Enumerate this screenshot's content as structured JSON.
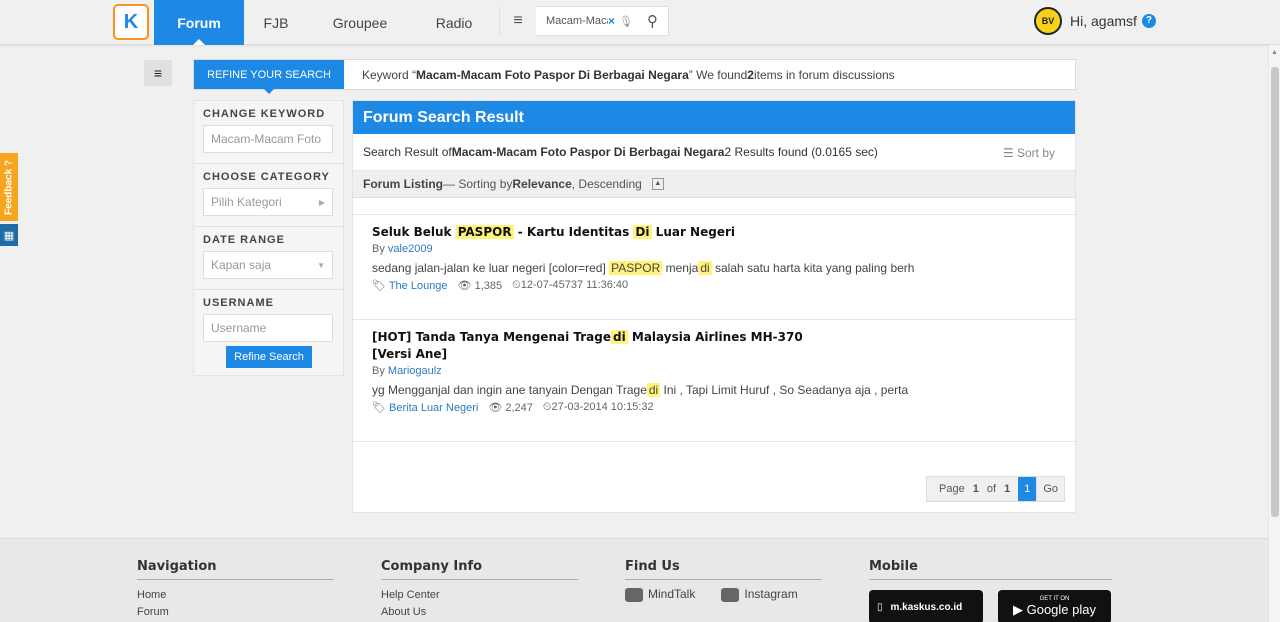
{
  "nav": {
    "logo": "K",
    "tabs": [
      "Forum",
      "FJB",
      "Groupee",
      "Radio"
    ],
    "search_value": "Macam-Macam Foto Paspor Di Berbagai Negara",
    "user_greeting": "Hi, agamsf",
    "avatar_text": "BV"
  },
  "feedback": "Feedback ?",
  "refine": {
    "tab_label": "REFINE YOUR SEARCH",
    "keyword_prefix": "Keyword “",
    "keyword": "Macam-Macam Foto Paspor Di Berbagai Negara",
    "keyword_suffix_1": "” We found ",
    "count": "2",
    "keyword_suffix_2": " items in forum discussions"
  },
  "sidebar": {
    "change_keyword": "CHANGE KEYWORD",
    "keyword_value": "Macam-Macam Foto",
    "choose_category": "CHOOSE CATEGORY",
    "category_placeholder": "Pilih Kategori",
    "date_range": "DATE RANGE",
    "date_value": "Kapan saja",
    "username": "USERNAME",
    "username_placeholder": "Username",
    "button": "Refine Search"
  },
  "results": {
    "header": "Forum Search Result",
    "summary_prefix": "Search Result of ",
    "summary_keyword": "Macam-Macam Foto Paspor Di Berbagai Negara",
    "summary_suffix": " 2 Results found (0.0165 sec)",
    "sort_by": "Sort by",
    "listing_label": "Forum Listing",
    "listing_sorting": " — Sorting by ",
    "listing_relevance": "Relevance",
    "listing_order": ", Descending",
    "threads": [
      {
        "title_parts": [
          "Seluk Beluk ",
          "PASPOR",
          " - Kartu Identitas ",
          "Di",
          " Luar Negeri"
        ],
        "by": "By ",
        "author": "vale2009",
        "snippet_parts": [
          "sedang jalan-jalan ke luar negeri [color=red] ",
          "PASPOR",
          " menja",
          "di",
          " salah satu harta kita yang paling berh"
        ],
        "category": "The Lounge",
        "views": "1,385",
        "date": "12-07-45737 11:36:40"
      },
      {
        "title_parts": [
          "[HOT] Tanda Tanya Mengenai Trage",
          "di",
          " Malaysia Airlines MH-370"
        ],
        "title_line2": "[Versi Ane]",
        "by": "By ",
        "author": "Mariogaulz",
        "snippet_parts": [
          "yg Mengganjal dan ingin ane tanyain Dengan Trage",
          "di",
          " Ini , Tapi Limit Huruf , So Seadanya aja , perta"
        ],
        "category": "Berita Luar Negeri",
        "views": "2,247",
        "date": "27-03-2014 10:15:32"
      }
    ],
    "pager": {
      "label_prefix": "Page ",
      "page": "1",
      "of": " of ",
      "total": "1",
      "current": "1",
      "go": "Go"
    }
  },
  "footer": {
    "navigation": {
      "title": "Navigation",
      "links": [
        "Home",
        "Forum"
      ]
    },
    "company": {
      "title": "Company Info",
      "links": [
        "Help Center",
        "About Us"
      ]
    },
    "findus": {
      "title": "Find Us",
      "links": [
        "MindTalk",
        "Instagram"
      ]
    },
    "mobile": {
      "title": "Mobile",
      "site": "m.kaskus.co.id",
      "store_top": "GET IT ON",
      "store": "Google play"
    }
  }
}
